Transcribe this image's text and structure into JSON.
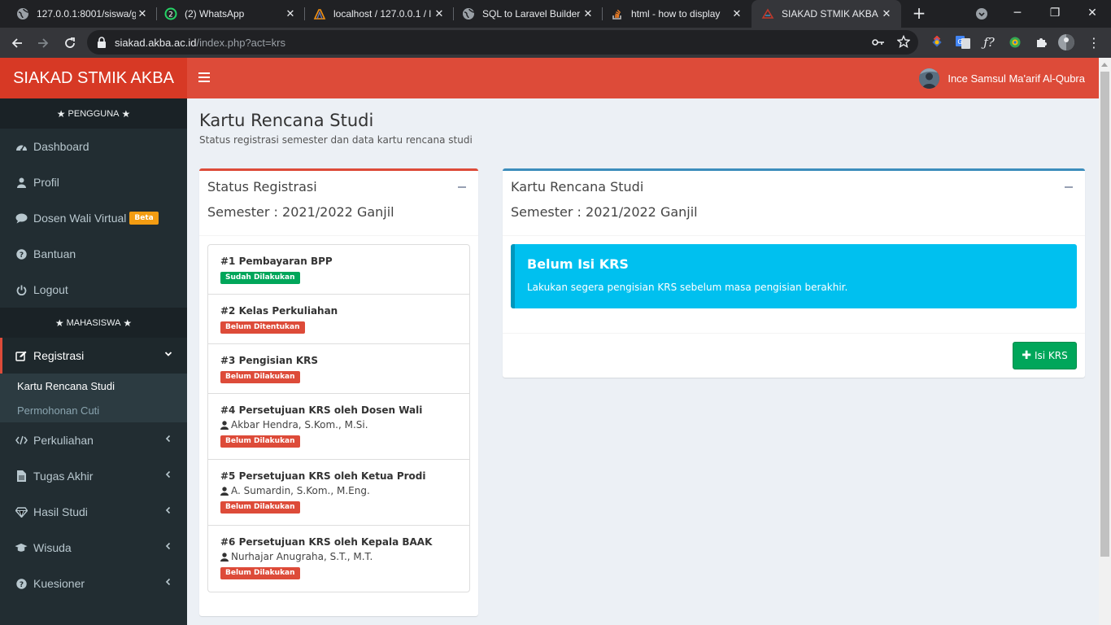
{
  "browser": {
    "tabs": [
      {
        "title": "127.0.0.1:8001/siswa/g",
        "icon": "globe-icon"
      },
      {
        "title": "(2) WhatsApp",
        "icon": "whatsapp-icon",
        "badge": "2"
      },
      {
        "title": "localhost / 127.0.0.1 / l",
        "icon": "phpmyadmin-icon"
      },
      {
        "title": "SQL to Laravel Builder",
        "icon": "globe-icon"
      },
      {
        "title": "html - how to display",
        "icon": "stackoverflow-icon"
      },
      {
        "title": "SIAKAD STMIK AKBA :",
        "icon": "siakad-icon",
        "active": true
      }
    ],
    "url_host": "siakad.akba.ac.id",
    "url_path": "/index.php?act=krs",
    "accent": "#35363a"
  },
  "app": {
    "logo": "SIAKAD STMIK AKBA",
    "user_name": "Ince Samsul Ma'arif Al-Qubra",
    "brand_color": "#dd4b39"
  },
  "sidebar": {
    "header_pengguna": "PENGGUNA",
    "header_mahasiswa": "MAHASISWA",
    "pengguna_items": [
      {
        "label": "Dashboard",
        "icon": "dashboard-icon"
      },
      {
        "label": "Profil",
        "icon": "user-icon"
      },
      {
        "label": "Dosen Wali Virtual",
        "icon": "comment-icon",
        "badge": "Beta"
      },
      {
        "label": "Bantuan",
        "icon": "question-icon"
      },
      {
        "label": "Logout",
        "icon": "power-icon"
      }
    ],
    "registrasi": {
      "label": "Registrasi",
      "icon": "edit-icon"
    },
    "registrasi_sub": [
      {
        "label": "Kartu Rencana Studi",
        "current": true
      },
      {
        "label": "Permohonan Cuti",
        "current": false
      }
    ],
    "more_items": [
      {
        "label": "Perkuliahan",
        "icon": "code-icon"
      },
      {
        "label": "Tugas Akhir",
        "icon": "file-icon"
      },
      {
        "label": "Hasil Studi",
        "icon": "diamond-icon"
      },
      {
        "label": "Wisuda",
        "icon": "graduation-cap-icon"
      },
      {
        "label": "Kuesioner",
        "icon": "question-icon"
      }
    ]
  },
  "page": {
    "title": "Kartu Rencana Studi",
    "subtitle": "Status registrasi semester dan data kartu rencana studi"
  },
  "status_box": {
    "title": "Status Registrasi",
    "semester": "Semester : 2021/2022 Ganjil",
    "steps": [
      {
        "title": "#1 Pembayaran BPP",
        "status": "Sudah Dilakukan",
        "status_color": "#00a65a"
      },
      {
        "title": "#2 Kelas Perkuliahan",
        "status": "Belum Ditentukan",
        "status_color": "#dd4b39"
      },
      {
        "title": "#3 Pengisian KRS",
        "status": "Belum Dilakukan",
        "status_color": "#dd4b39"
      },
      {
        "title": "#4 Persetujuan KRS oleh Dosen Wali",
        "person": "Akbar Hendra, S.Kom., M.Si.",
        "status": "Belum Dilakukan",
        "status_color": "#dd4b39"
      },
      {
        "title": "#5 Persetujuan KRS oleh Ketua Prodi",
        "person": "A. Sumardin, S.Kom., M.Eng.",
        "status": "Belum Dilakukan",
        "status_color": "#dd4b39"
      },
      {
        "title": "#6 Persetujuan KRS oleh Kepala BAAK",
        "person": "Nurhajar Anugraha, S.T., M.T.",
        "status": "Belum Dilakukan",
        "status_color": "#dd4b39"
      }
    ]
  },
  "krs_box": {
    "title": "Kartu Rencana Studi",
    "semester": "Semester : 2021/2022 Ganjil",
    "callout_title": "Belum Isi KRS",
    "callout_text": "Lakukan segera pengisian KRS sebelum masa pengisian berakhir.",
    "callout_color": "#00c0ef",
    "button_label": "Isi KRS"
  }
}
